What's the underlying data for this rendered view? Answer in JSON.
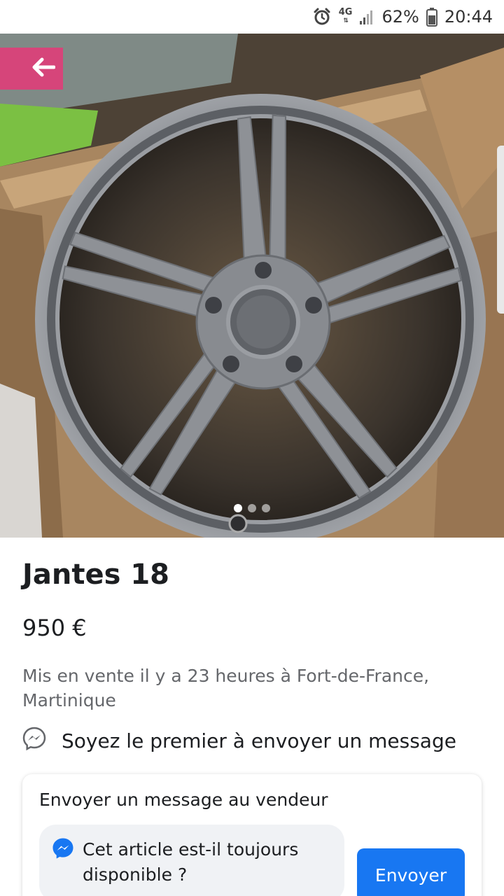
{
  "status_bar": {
    "network": "4G",
    "battery_percent": "62%",
    "time": "20:44",
    "icons": [
      "alarm-icon",
      "signal-icon",
      "battery-icon"
    ]
  },
  "gallery": {
    "image_count": 3,
    "active_index": 0
  },
  "listing": {
    "title": "Jantes 18",
    "price": "950 €",
    "listed_info": "Mis en vente il y a 23 heures à Fort-de-France, Martinique",
    "first_message_prompt": "Soyez le premier à envoyer un message"
  },
  "message_card": {
    "title": "Envoyer un message au vendeur",
    "message_text": "Cet article est-il toujours disponible ?",
    "send_label": "Envoyer"
  },
  "colors": {
    "accent": "#1877f2",
    "secondary_text": "#65676b",
    "bubble_bg": "#f0f2f5"
  }
}
